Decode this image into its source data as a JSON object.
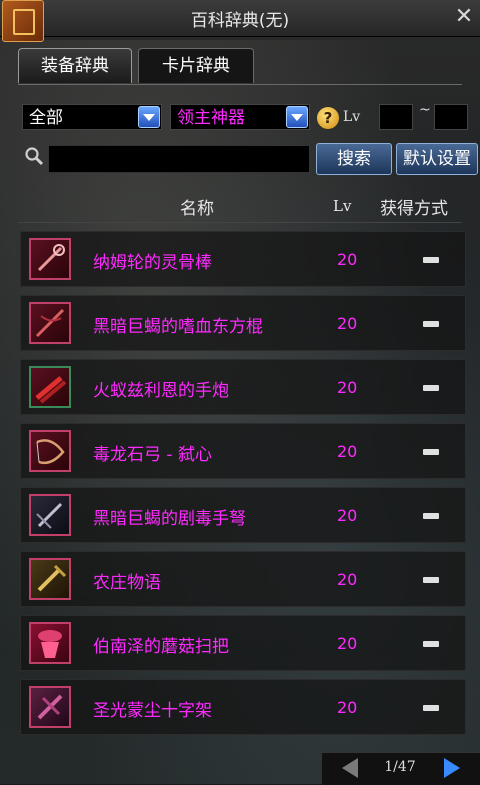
{
  "window": {
    "title": "百科辞典(无)",
    "close_label": "✕"
  },
  "tabs": [
    {
      "label": "装备辞典",
      "active": true
    },
    {
      "label": "卡片辞典",
      "active": false
    }
  ],
  "filters": {
    "category": "全部",
    "subcategory": "领主神器",
    "help_label": "?",
    "lv_label": "Lv",
    "lv_min": "",
    "lv_max": "",
    "lv_separator": "~"
  },
  "search": {
    "value": "",
    "search_button": "搜索",
    "reset_button": "默认设置"
  },
  "table": {
    "headers": {
      "name": "名称",
      "lv": "Lv",
      "source": "获得方式"
    },
    "rows": [
      {
        "name": "纳姆轮的灵骨棒",
        "lv": "20",
        "icon": "bone-staff-icon"
      },
      {
        "name": "黑暗巨蝎的嗜血东方棍",
        "lv": "20",
        "icon": "staff-icon"
      },
      {
        "name": "火蚁兹利恩的手炮",
        "lv": "20",
        "icon": "hand-cannon-icon"
      },
      {
        "name": "毒龙石弓 - 弑心",
        "lv": "20",
        "icon": "bow-icon"
      },
      {
        "name": "黑暗巨蝎的剧毒手弩",
        "lv": "20",
        "icon": "crossbow-icon"
      },
      {
        "name": "农庄物语",
        "lv": "20",
        "icon": "farm-tool-icon"
      },
      {
        "name": "伯南泽的蘑菇扫把",
        "lv": "20",
        "icon": "broom-icon"
      },
      {
        "name": "圣光蒙尘十字架",
        "lv": "20",
        "icon": "cross-icon"
      }
    ]
  },
  "pagination": {
    "text": "1/47"
  },
  "colors": {
    "item_name": "#ff2aff",
    "accent": "#3a8aff"
  }
}
